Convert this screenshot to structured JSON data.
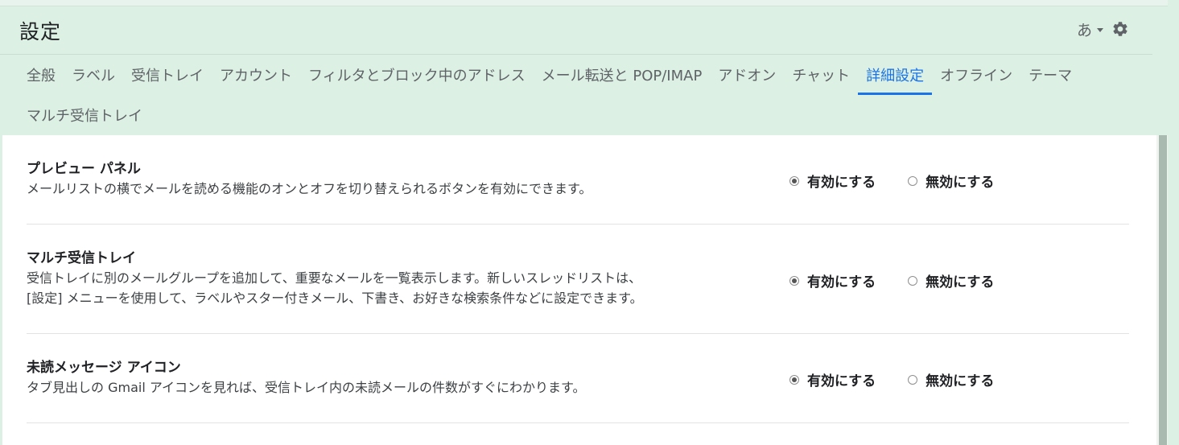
{
  "header": {
    "title": "設定",
    "ime_label": "あ"
  },
  "tabs": [
    {
      "label": "全般"
    },
    {
      "label": "ラベル"
    },
    {
      "label": "受信トレイ"
    },
    {
      "label": "アカウント"
    },
    {
      "label": "フィルタとブロック中のアドレス"
    },
    {
      "label": "メール転送と POP/IMAP"
    },
    {
      "label": "アドオン"
    },
    {
      "label": "チャット"
    },
    {
      "label": "詳細設定",
      "active": true
    },
    {
      "label": "オフライン"
    },
    {
      "label": "テーマ"
    },
    {
      "label": "マルチ受信トレイ"
    }
  ],
  "settings": [
    {
      "title": "プレビュー パネル",
      "description_lines": [
        "メールリストの横でメールを読める機能のオンとオフを切り替えられるボタンを有効にできます。"
      ],
      "enable_label": "有効にする",
      "disable_label": "無効にする",
      "selected": "enable"
    },
    {
      "title": "マルチ受信トレイ",
      "description_lines": [
        "受信トレイに別のメールグループを追加して、重要なメールを一覧表示します。新しいスレッドリストは、",
        "[設定] メニューを使用して、ラベルやスター付きメール、下書き、お好きな検索条件などに設定できます。"
      ],
      "enable_label": "有効にする",
      "disable_label": "無効にする",
      "selected": "enable"
    },
    {
      "title": "未読メッセージ アイコン",
      "description_lines": [
        "タブ見出しの Gmail アイコンを見れば、受信トレイ内の未読メールの件数がすぐにわかります。"
      ],
      "enable_label": "有効にする",
      "disable_label": "無効にする",
      "selected": "enable"
    }
  ],
  "icons": {
    "ime_caret": "caret-down-icon",
    "settings": "gear-icon"
  },
  "colors": {
    "background": "#dcf0e3",
    "active_tab": "#1a73e8",
    "panel": "#ffffff"
  }
}
